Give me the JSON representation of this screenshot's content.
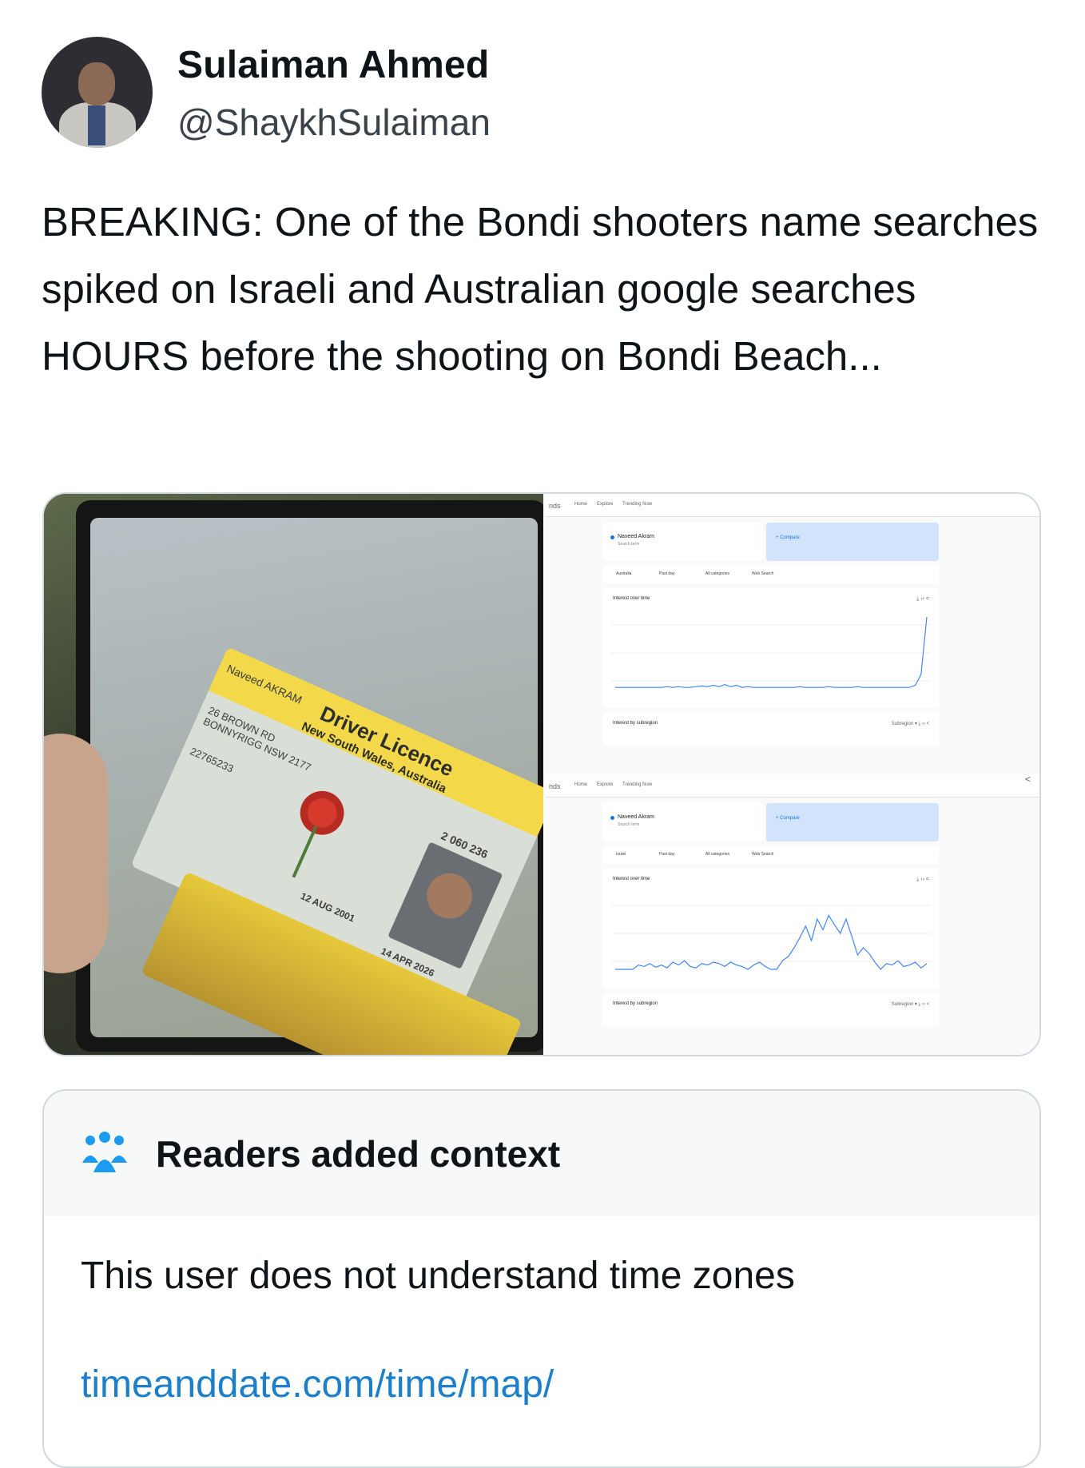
{
  "author": {
    "name": "Sulaiman Ahmed",
    "handle": "@ShaykhSulaiman"
  },
  "tweet": {
    "text": "BREAKING: One of the Bondi shooters name searches spiked on Israeli and Australian google searches HOURS before the shooting on Bondi Beach..."
  },
  "media": {
    "license": {
      "title": "Driver Licence",
      "subtitle": "New South Wales, Australia",
      "holder": "Naveed AKRAM",
      "address": "26 BROWN RD BONNYRIGG NSW 2177",
      "licence_no": "22765233",
      "dob": "12 AUG 2001",
      "expiry": "14 APR 2026",
      "card_no": "2 060 236"
    },
    "trends_top": {
      "brand": "nds",
      "nav": [
        "Home",
        "Explore",
        "Trending Now"
      ],
      "term": "Naveed Akram",
      "term_sub": "Search term",
      "compare": "+ Compare",
      "filters": [
        "Australia",
        "Past day",
        "All categories",
        "Web Search"
      ],
      "interest_title": "Interest over time",
      "subregion_title": "Interest by subregion",
      "subregion_menu": "Subregion",
      "series": [
        2,
        2,
        2,
        2,
        2,
        2,
        2,
        2,
        2,
        3,
        2,
        3,
        2,
        2,
        3,
        4,
        3,
        5,
        3,
        6,
        3,
        5,
        2,
        3,
        2,
        2,
        2,
        2,
        2,
        2,
        2,
        2,
        3,
        2,
        2,
        2,
        2,
        3,
        2,
        2,
        2,
        2,
        3,
        2,
        2,
        2,
        2,
        2,
        2,
        2,
        2,
        2,
        5,
        20,
        100
      ]
    },
    "trends_bottom": {
      "brand": "nds",
      "nav": [
        "Home",
        "Explore",
        "Trending Now"
      ],
      "term": "Naveed Akram",
      "term_sub": "Search term",
      "compare": "+ Compare",
      "filters": [
        "Israel",
        "Past day",
        "All categories",
        "Web Search"
      ],
      "interest_title": "Interest over time",
      "subregion_title": "Interest by subregion",
      "subregion_menu": "Subregion",
      "series": [
        0,
        0,
        0,
        0,
        6,
        4,
        8,
        3,
        6,
        2,
        10,
        6,
        12,
        4,
        2,
        8,
        6,
        10,
        8,
        4,
        10,
        6,
        4,
        0,
        6,
        10,
        4,
        0,
        0,
        12,
        18,
        30,
        44,
        60,
        40,
        70,
        55,
        75,
        62,
        50,
        70,
        46,
        20,
        30,
        22,
        10,
        0,
        8,
        6,
        12,
        4,
        6,
        10,
        2,
        8
      ]
    }
  },
  "context": {
    "title": "Readers added context",
    "body": "This user does not understand time zones",
    "link": "timeanddate.com/time/map/"
  }
}
